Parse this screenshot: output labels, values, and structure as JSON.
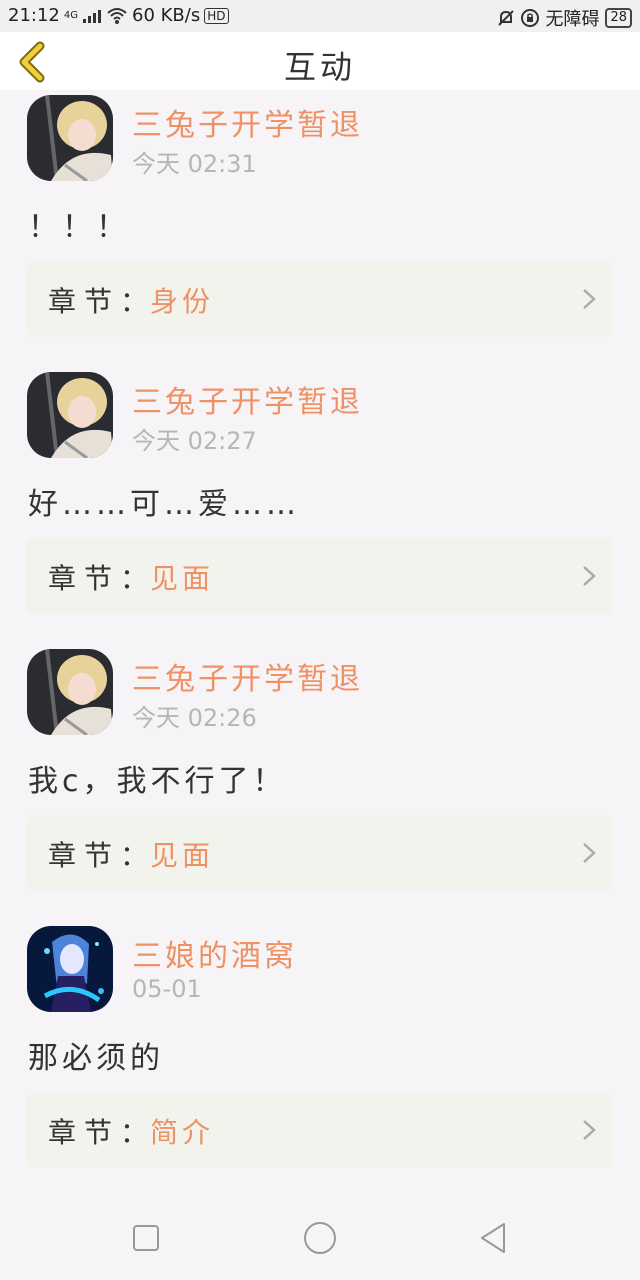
{
  "status": {
    "time": "21:12",
    "network": "4G",
    "speed": "60 KB/s",
    "hd": "HD",
    "accessibility": "无障碍",
    "battery": "28"
  },
  "header": {
    "title": "互动"
  },
  "comments": [
    {
      "user": "三兔子开学暂退",
      "time": "今天 02:31",
      "text": "！！！",
      "chapter_label": "章节：",
      "chapter": "身份",
      "avatar": "blonde-character-avatar"
    },
    {
      "user": "三兔子开学暂退",
      "time": "今天 02:27",
      "text": "好……可…爱……",
      "chapter_label": "章节：",
      "chapter": "见面",
      "avatar": "blonde-character-avatar"
    },
    {
      "user": "三兔子开学暂退",
      "time": "今天 02:26",
      "text": "我c，我不行了！",
      "chapter_label": "章节：",
      "chapter": "见面",
      "avatar": "blonde-character-avatar"
    },
    {
      "user": "三娘的酒窝",
      "time": "05-01",
      "text": "那必须的",
      "chapter_label": "章节：",
      "chapter": "简介",
      "avatar": "blue-anime-girl-avatar"
    }
  ],
  "colors": {
    "accent": "#ee9266",
    "card": "#f3f3ee",
    "background": "#f7f4f7"
  }
}
